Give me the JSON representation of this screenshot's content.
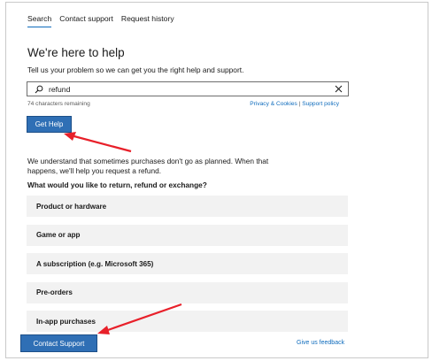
{
  "tabs": [
    {
      "label": "Search",
      "active": true
    },
    {
      "label": "Contact support",
      "active": false
    },
    {
      "label": "Request history",
      "active": false
    }
  ],
  "heading": "We're here to help",
  "subtext": "Tell us your problem so we can get you the right help and support.",
  "search": {
    "value": "refund",
    "char_count": "74 characters remaining"
  },
  "policy": {
    "privacy": "Privacy & Cookies",
    "separator": "|",
    "support": "Support policy"
  },
  "get_help_label": "Get Help",
  "refund_text": "We understand that sometimes purchases don't go as planned. When that happens, we'll help you request a refund.",
  "question": "What would you like to return, refund or exchange?",
  "options": [
    "Product or hardware",
    "Game or app",
    "A subscription (e.g. Microsoft 365)",
    "Pre-orders",
    "In-app purchases"
  ],
  "footer": {
    "contact_label": "Contact Support",
    "feedback_label": "Give us feedback"
  },
  "colors": {
    "accent": "#0f6cbd",
    "button": "#2f6fb5",
    "annotation_arrow": "#e8202a",
    "option_bg": "#f2f2f2"
  }
}
